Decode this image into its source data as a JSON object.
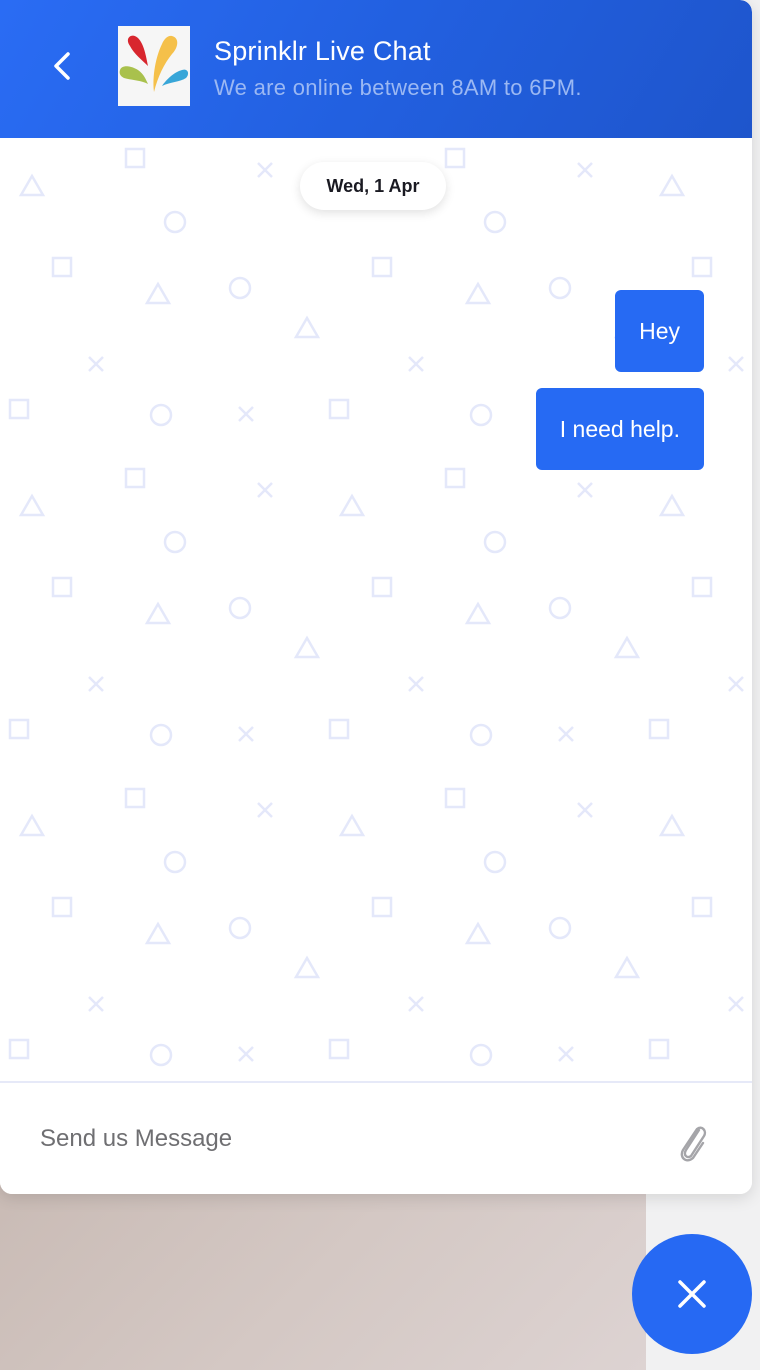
{
  "header": {
    "title": "Sprinklr Live Chat",
    "subtitle": "We are online between 8AM to 6PM.",
    "back_icon": "chevron-left-icon",
    "logo": "sprinklr-logo"
  },
  "conversation": {
    "date_separator": "Wed, 1 Apr",
    "messages": [
      {
        "sender": "user",
        "text": "Hey"
      },
      {
        "sender": "user",
        "text": "I need help."
      }
    ]
  },
  "composer": {
    "placeholder": "Send us Message",
    "value": "",
    "attach_icon": "paperclip-icon"
  },
  "launcher": {
    "close_icon": "close-icon"
  },
  "colors": {
    "brand_blue": "#266af3",
    "header_gradient_start": "#2a6cf4",
    "header_gradient_end": "#1e55cc",
    "pattern_shape": "#e4e8fa"
  }
}
